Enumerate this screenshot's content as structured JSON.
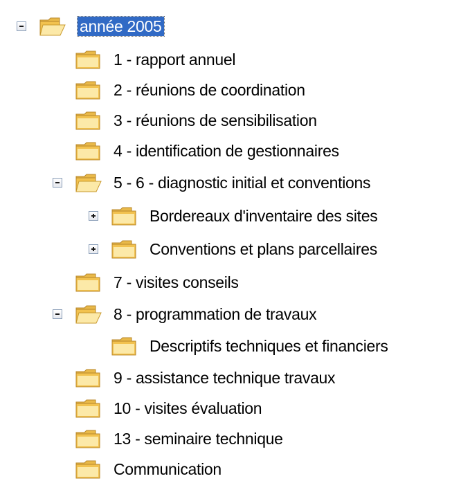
{
  "tree": {
    "root": {
      "label": "année 2005",
      "expanded": true,
      "selected": true
    },
    "items": [
      {
        "label": "1 - rapport annuel"
      },
      {
        "label": "2 - réunions de coordination"
      },
      {
        "label": "3 - réunions de sensibilisation"
      },
      {
        "label": "4 - identification de gestionnaires"
      },
      {
        "label": "5 - 6 - diagnostic initial et conventions",
        "expanded": true,
        "children": [
          {
            "label": "Bordereaux d'inventaire des sites",
            "expanded": false
          },
          {
            "label": "Conventions et plans parcellaires",
            "expanded": false
          }
        ]
      },
      {
        "label": "7 - visites conseils"
      },
      {
        "label": "8 - programmation de travaux",
        "expanded": true,
        "children": [
          {
            "label": "Descriptifs techniques et financiers"
          }
        ]
      },
      {
        "label": "9 - assistance technique travaux"
      },
      {
        "label": "10 - visites évaluation"
      },
      {
        "label": "13 - seminaire technique"
      },
      {
        "label": "Communication"
      }
    ]
  },
  "colors": {
    "selection_bg": "#316ac5",
    "folder_light": "#fce9a8",
    "folder_mid": "#f2c24f",
    "folder_dark": "#c99a2e"
  },
  "icons": {
    "folder": "folder-icon",
    "collapse": "minus-box-icon",
    "expand": "plus-box-icon"
  }
}
